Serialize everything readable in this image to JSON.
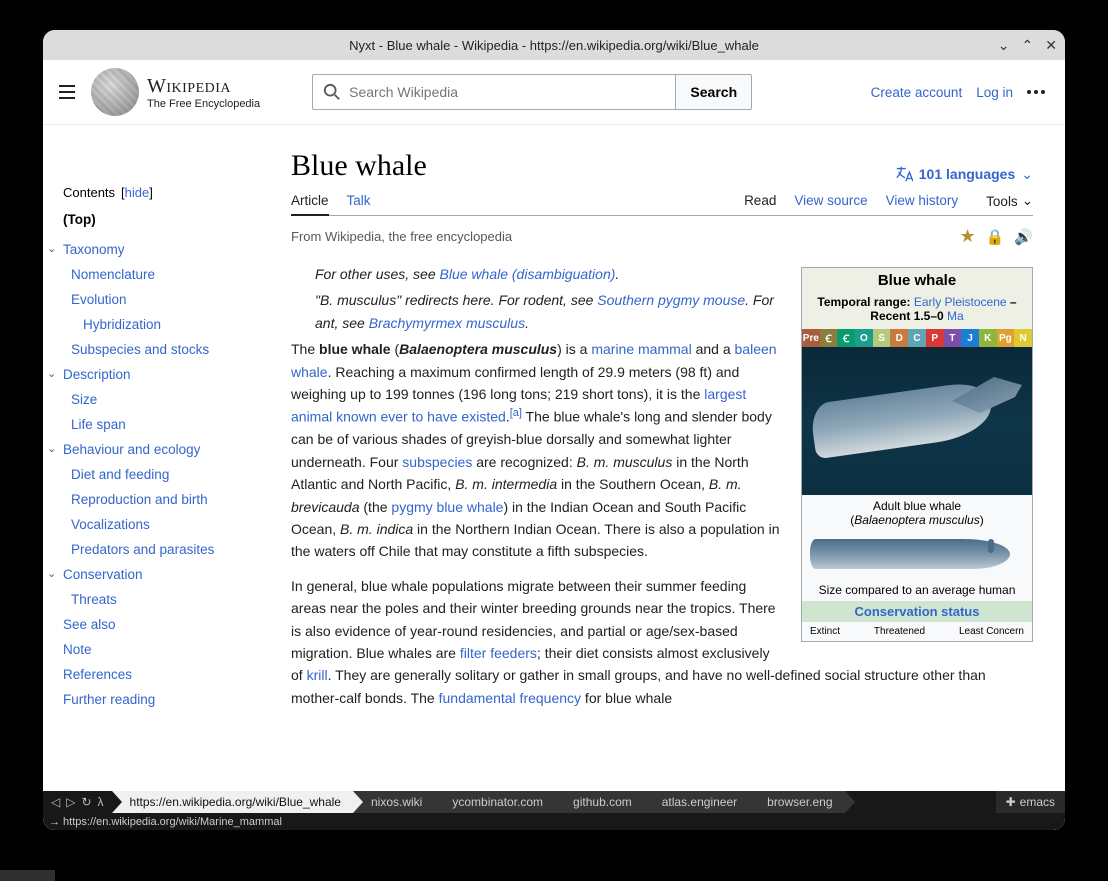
{
  "window_title": "Nyxt - Blue whale - Wikipedia - https://en.wikipedia.org/wiki/Blue_whale",
  "header": {
    "wordmark": "Wikipedia",
    "tagline": "The Free Encyclopedia",
    "search_placeholder": "Search Wikipedia",
    "search_btn": "Search",
    "create_account": "Create account",
    "login": "Log in"
  },
  "sidebar": {
    "contents": "Contents",
    "hide": "hide",
    "top": "(Top)",
    "items": [
      "Taxonomy",
      "Nomenclature",
      "Evolution",
      "Hybridization",
      "Subspecies and stocks",
      "Description",
      "Size",
      "Life span",
      "Behaviour and ecology",
      "Diet and feeding",
      "Reproduction and birth",
      "Vocalizations",
      "Predators and parasites",
      "Conservation",
      "Threats",
      "See also",
      "Note",
      "References",
      "Further reading"
    ]
  },
  "article": {
    "title": "Blue whale",
    "languages": "101 languages",
    "tabs": {
      "article": "Article",
      "talk": "Talk",
      "read": "Read",
      "view_source": "View source",
      "view_history": "View history",
      "tools": "Tools"
    },
    "subtitle": "From Wikipedia, the free encyclopedia",
    "hatnote1_pre": "For other uses, see ",
    "hatnote1_link": "Blue whale (disambiguation)",
    "hatnote2_a": "\"B. musculus\" redirects here. For rodent, see ",
    "hatnote2_link1": "Southern pygmy mouse",
    "hatnote2_b": ". For ant, see ",
    "hatnote2_link2": "Brachymyrmex musculus",
    "p1": {
      "t0": "The ",
      "bw": "blue whale",
      "t1": " (",
      "sci": "Balaenoptera musculus",
      "t2": ") is a ",
      "mm": "marine mammal",
      "t3": " and a ",
      "bal": "baleen whale",
      "t4": ". Reaching a maximum confirmed length of 29.9 meters (98 ft) and weighing up to 199 tonnes (196 long tons; 219 short tons), it is the ",
      "la": "largest animal known ever to have existed",
      "t5": ".",
      "ref": "[a]",
      "t6": " The blue whale's long and slender body can be of various shades of greyish-blue dorsally and somewhat lighter underneath. Four ",
      "sub": "subspecies",
      "t7": " are recognized: ",
      "s1": "B. m. musculus",
      "t8": " in the North Atlantic and North Pacific, ",
      "s2": "B. m. intermedia",
      "t9": " in the Southern Ocean, ",
      "s3": "B. m. brevicauda",
      "t10": " (the ",
      "pbw": "pygmy blue whale",
      "t11": ") in the Indian Ocean and South Pacific Ocean, ",
      "s4": "B. m. indica",
      "t12": " in the Northern Indian Ocean. There is also a population in the waters off Chile that may constitute a fifth subspecies."
    },
    "p2": {
      "t0": "In general, blue whale populations migrate between their summer feeding areas near the poles and their winter breeding grounds near the tropics. There is also evidence of year-round residencies, and partial or age/sex-based migration. Blue whales are ",
      "ff": "filter feeders",
      "t1": "; their diet consists almost exclusively of ",
      "kr": "krill",
      "t2": ". They are generally solitary or gather in small groups, and have no well-defined social structure other than mother-calf bonds. The ",
      "fund": "fundamental frequency",
      "t3": " for blue whale"
    }
  },
  "infobox": {
    "title": "Blue whale",
    "temporal_label": "Temporal range: ",
    "temporal_link": "Early Pleistocene",
    "temporal_rest": " – Recent 1.5–0 ",
    "ma": "Ma",
    "geo": [
      "Pre",
      "Ꞓ",
      "Ꞓ",
      "O",
      "S",
      "D",
      "C",
      "P",
      "T",
      "J",
      "K",
      "Pg",
      "N"
    ],
    "geo_colors": [
      "#a85d3e",
      "#8b7d3a",
      "#089c6e",
      "#1b9e8e",
      "#b5c97a",
      "#c97a3e",
      "#5ea5b5",
      "#d93838",
      "#7d4fa8",
      "#1b7dd4",
      "#8fb53e",
      "#e0a030",
      "#e0c830"
    ],
    "caption1a": "Adult blue whale",
    "caption1b": "Balaenoptera musculus",
    "caption2": "Size compared to an average human",
    "cons_status": "Conservation status",
    "extinct": "Extinct",
    "threatened": "Threatened",
    "least": "Least Concern"
  },
  "bottom": {
    "url_tab": "https://en.wikipedia.org/wiki/Blue_whale",
    "tabs": [
      "nixos.wiki",
      "ycombinator.com",
      "github.com",
      "atlas.engineer",
      "browser.eng"
    ],
    "emacs": "emacs",
    "status": "→ https://en.wikipedia.org/wiki/Marine_mammal"
  }
}
